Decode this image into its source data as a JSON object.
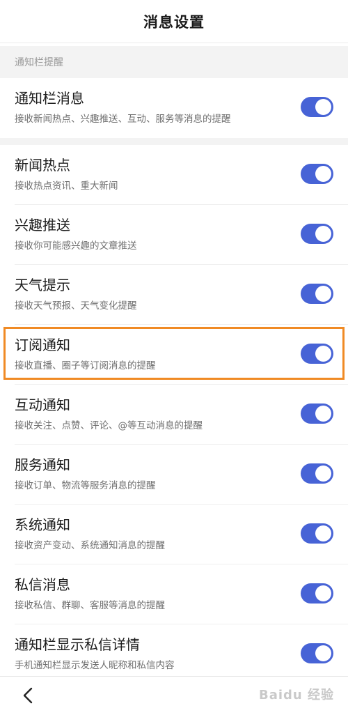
{
  "header": {
    "title": "消息设置"
  },
  "section": {
    "label": "通知栏提醒"
  },
  "settings": [
    {
      "title": "通知栏消息",
      "subtitle": "接收新闻热点、兴趣推送、互动、服务等消息的提醒",
      "enabled": true
    },
    {
      "title": "新闻热点",
      "subtitle": "接收热点资讯、重大新闻",
      "enabled": true
    },
    {
      "title": "兴趣推送",
      "subtitle": "接收你可能感兴趣的文章推送",
      "enabled": true
    },
    {
      "title": "天气提示",
      "subtitle": "接收天气预报、天气变化提醒",
      "enabled": true
    },
    {
      "title": "订阅通知",
      "subtitle": "接收直播、圈子等订阅消息的提醒",
      "enabled": true
    },
    {
      "title": "互动通知",
      "subtitle": "接收关注、点赞、评论、@等互动消息的提醒",
      "enabled": true
    },
    {
      "title": "服务通知",
      "subtitle": "接收订单、物流等服务消息的提醒",
      "enabled": true
    },
    {
      "title": "系统通知",
      "subtitle": "接收资产变动、系统通知消息的提醒",
      "enabled": true
    },
    {
      "title": "私信消息",
      "subtitle": "接收私信、群聊、客服等消息的提醒",
      "enabled": true
    },
    {
      "title": "通知栏显示私信详情",
      "subtitle": "手机通知栏显示发送人昵称和私信内容",
      "enabled": true
    }
  ],
  "watermark": {
    "text": "Baidu 经验"
  },
  "colors": {
    "toggle_on": "#4763d6",
    "highlight": "#f08a24"
  }
}
